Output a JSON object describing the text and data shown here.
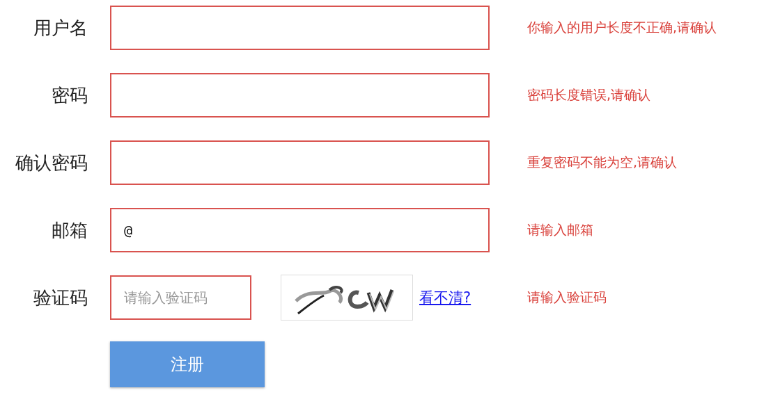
{
  "fields": [
    {
      "kind": "text",
      "label": "用户名",
      "invalid": true,
      "error": "你输入的用户长度不正确,请确认"
    },
    {
      "kind": "text",
      "label": "密码",
      "invalid": true,
      "error": "密码长度错误,请确认"
    },
    {
      "kind": "text",
      "label": "确认密码",
      "invalid": true,
      "error": "重复密码不能为空,请确认"
    },
    {
      "kind": "text",
      "label": "邮箱",
      "value": "@",
      "invalid": true,
      "error": "请输入邮箱"
    },
    {
      "kind": "captcha",
      "label": "验证码",
      "placeholder": "请输入验证码",
      "invalid": true,
      "refresh_link": "看不清?",
      "error": "请输入验证码"
    }
  ],
  "submit": "注册"
}
